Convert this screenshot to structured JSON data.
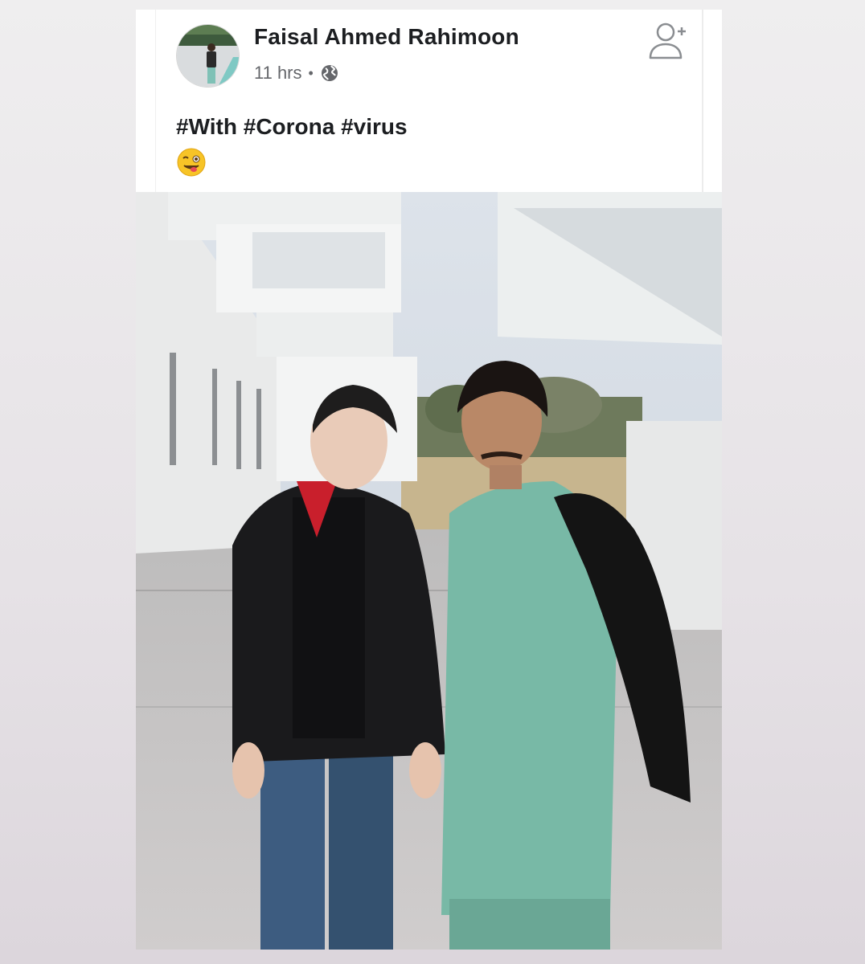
{
  "post": {
    "author": "Faisal Ahmed Rahimoon",
    "time": "11 hrs",
    "separator": "•",
    "caption": "#With #Corona #virus",
    "emoji": "winking-face-with-tongue",
    "privacy_icon": "globe-icon",
    "action_icon": "add-friend-icon"
  },
  "colors": {
    "name": "#1c1e21",
    "meta": "#65676b",
    "card": "#ffffff"
  }
}
